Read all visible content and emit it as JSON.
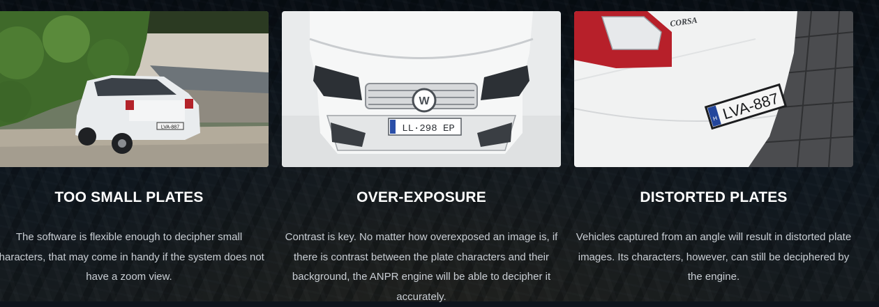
{
  "features": [
    {
      "title": "TOO SMALL PLATES",
      "description": "The software is flexible enough to decipher small characters, that may come in handy if the system does not have a zoom view.",
      "plate_text": "LVA-887",
      "image_alt": "White hatchback parked in front of a hedge"
    },
    {
      "title": "OVER-EXPOSURE",
      "description": "Contrast is key. No matter how overexposed an image is, if there is contrast between the plate characters and their background, the ANPR engine will be able to decipher it accurately.",
      "plate_text": "LL·298 EP",
      "image_alt": "Overexposed front of a Volkswagen"
    },
    {
      "title": "DISTORTED PLATES",
      "description": "Vehicles captured from an angle will result in distorted plate images. Its characters, however, can still be deciphered by the engine.",
      "plate_text": "LVA-887",
      "plate_country": "H",
      "car_badge": "CORSA",
      "image_alt": "Rear of a white car with angled license plate"
    }
  ],
  "colors": {
    "title": "#ffffff",
    "description": "#c9ced4",
    "background": "#0e141c"
  }
}
